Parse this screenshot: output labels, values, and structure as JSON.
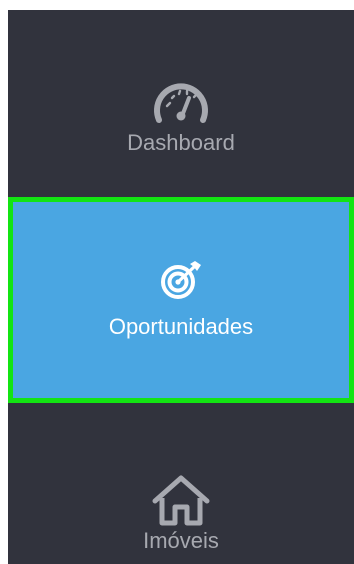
{
  "sidebar": {
    "colors": {
      "background": "#31333d",
      "active_background": "#4aa6e2",
      "active_border": "#13e413",
      "inactive_text": "#a7a9b0",
      "active_text": "#ffffff"
    },
    "items": [
      {
        "label": "Dashboard",
        "icon": "speedometer-icon",
        "active": false
      },
      {
        "label": "Oportunidades",
        "icon": "target-icon",
        "active": true
      },
      {
        "label": "Imóveis",
        "icon": "house-icon",
        "active": false
      }
    ]
  }
}
